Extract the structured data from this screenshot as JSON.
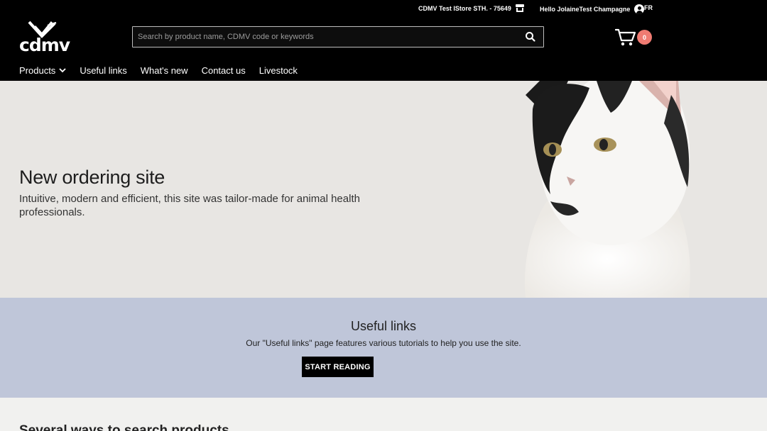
{
  "topbar": {
    "store": "CDMV Test IStore STH. - 75649",
    "user_greeting": "Hello JolaineTest Champagne",
    "language": "FR"
  },
  "logo": {
    "text": "cdmv"
  },
  "search": {
    "placeholder": "Search by product name, CDMV code or keywords"
  },
  "cart": {
    "count": "0"
  },
  "nav": {
    "products": "Products",
    "useful_links": "Useful links",
    "whats_new": "What's new",
    "contact_us": "Contact us",
    "livestock": "Livestock"
  },
  "hero": {
    "title": "New ordering site",
    "subtitle": "Intuitive, modern and efficient, this site was tailor-made for animal health professionals."
  },
  "useful_links": {
    "title": "Useful links",
    "text": "Our \"Useful links\" page features various tutorials to help you use the site.",
    "button": "START READING"
  },
  "next_section": {
    "title": "Several ways to search products"
  },
  "colors": {
    "header_bg": "#000000",
    "hero_bg": "#e8e6e3",
    "useful_bg": "#bfc6d9",
    "badge": "#ef7b72"
  }
}
